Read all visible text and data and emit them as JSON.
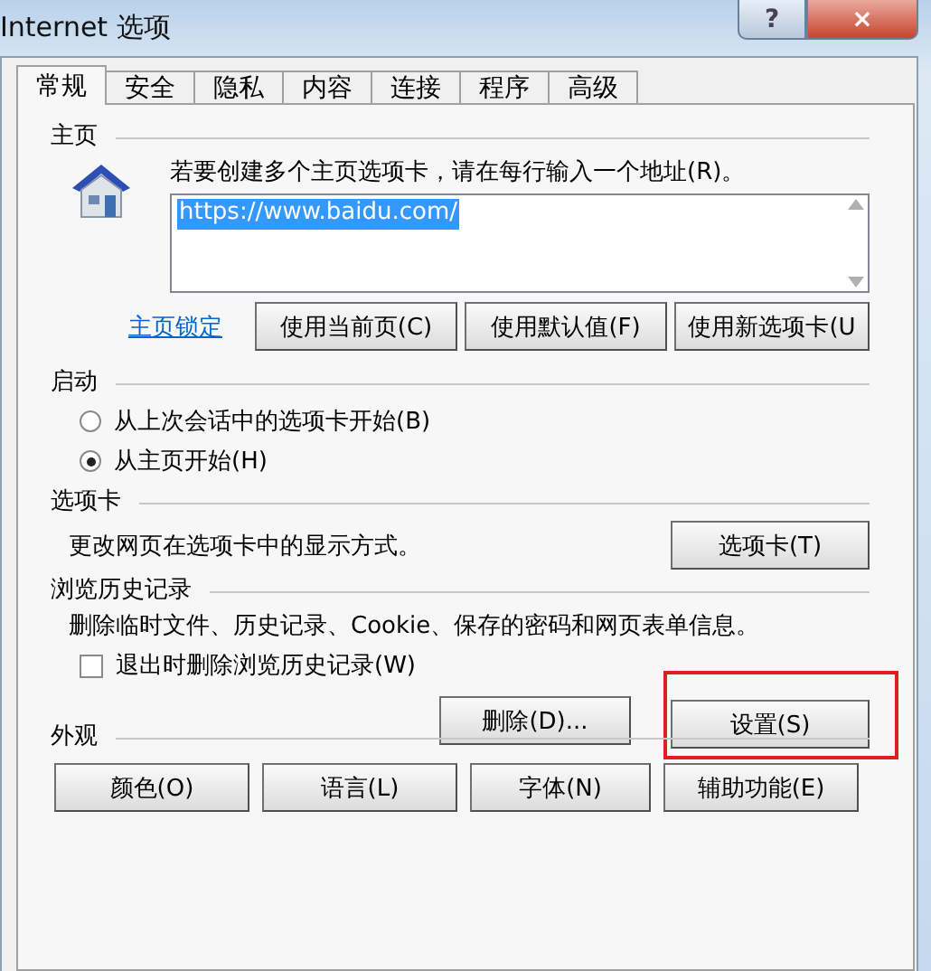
{
  "window": {
    "title": "Internet 选项",
    "help_button": "?",
    "close_button": "×"
  },
  "tabs": [
    {
      "label": "常规",
      "selected": true
    },
    {
      "label": "安全",
      "selected": false
    },
    {
      "label": "隐私",
      "selected": false
    },
    {
      "label": "内容",
      "selected": false
    },
    {
      "label": "连接",
      "selected": false
    },
    {
      "label": "程序",
      "selected": false
    },
    {
      "label": "高级",
      "selected": false
    }
  ],
  "homepage": {
    "heading": "主页",
    "hint": "若要创建多个主页选项卡，请在每行输入一个地址(R)。",
    "address": "https://www.baidu.com/",
    "address_selected": true,
    "lock_link": "主页锁定",
    "buttons": [
      "使用当前页(C)",
      "使用默认值(F)",
      "使用新选项卡(U"
    ]
  },
  "startup": {
    "heading": "启动",
    "options": [
      {
        "label": "从上次会话中的选项卡开始(B)",
        "selected": false
      },
      {
        "label": "从主页开始(H)",
        "selected": true
      }
    ]
  },
  "tabs_section": {
    "heading": "选项卡",
    "description": "更改网页在选项卡中的显示方式。",
    "button": "选项卡(T)"
  },
  "history": {
    "heading": "浏览历史记录",
    "description": "删除临时文件、历史记录、Cookie、保存的密码和网页表单信息。",
    "checkbox": {
      "label": "退出时删除浏览历史记录(W)",
      "checked": false
    },
    "buttons": [
      {
        "label": "删除(D)...",
        "highlighted": false
      },
      {
        "label": "设置(S)",
        "highlighted": true
      }
    ]
  },
  "appearance": {
    "heading": "外观",
    "buttons": [
      "颜色(O)",
      "语言(L)",
      "字体(N)",
      "辅助功能(E)"
    ]
  }
}
